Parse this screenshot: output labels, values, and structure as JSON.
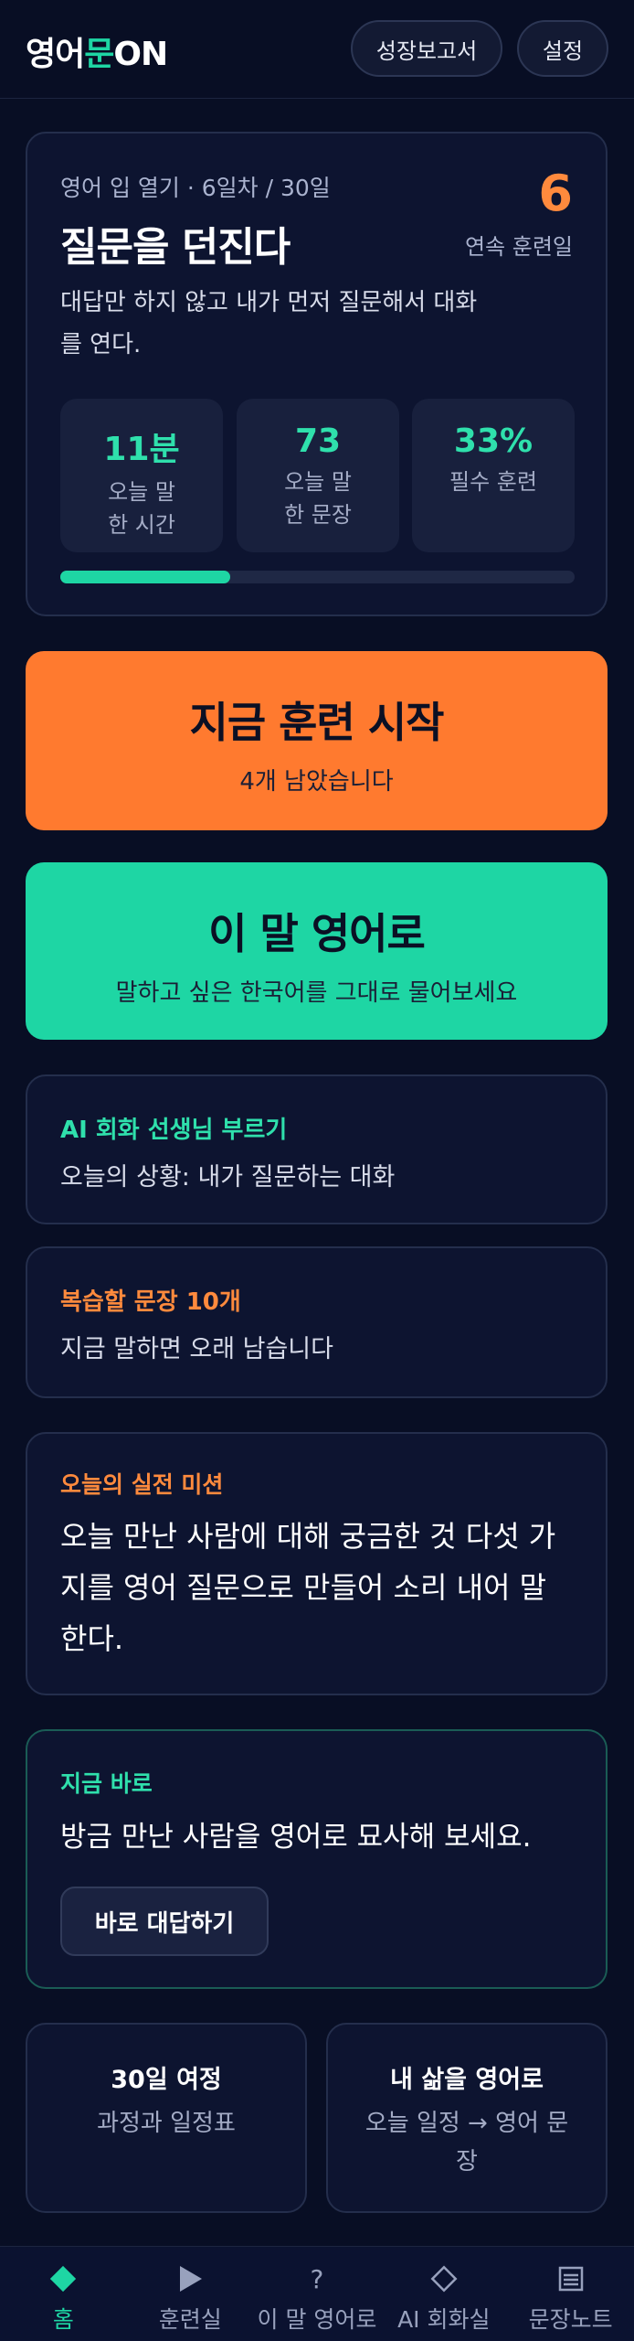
{
  "app": {
    "logo_part1": "영어",
    "logo_accent": "문",
    "logo_part2": "ON",
    "accent_color": "#1ed6a4",
    "orange_color": "#ff7a2f"
  },
  "header": {
    "report_label": "성장보고서",
    "settings_label": "설정"
  },
  "today_card": {
    "meta": "영어 입 열기 · 6일차 / 30일",
    "title": "질문을 던진다",
    "streak_value": "6",
    "streak_label": "연속 훈련일",
    "description": "대답만 하지 않고 내가 먼저 질문해서 대화를 연다.",
    "stats": [
      {
        "value": "11분",
        "label": "오늘 말한 시간"
      },
      {
        "value": "73",
        "label": "오늘 말한 문장"
      },
      {
        "value": "33%",
        "label": "필수 훈련"
      }
    ],
    "progress": 0.33
  },
  "start_training": {
    "title": "지금 훈련 시작",
    "subtitle": "4개 남았습니다"
  },
  "translate": {
    "title": "이 말 영어로",
    "subtitle": "말하고 싶은 한국어를 그대로 물어보세요"
  },
  "ai_tutor": {
    "title": "AI 회화 선생님 부르기",
    "text": "오늘의 상황: 내가 질문하는 대화"
  },
  "review": {
    "title": "복습할 문장 10개",
    "text": "지금 말하면 오래 남습니다"
  },
  "mission": {
    "title": "오늘의 실전 미션",
    "text": "오늘 만난 사람에 대해 궁금한 것 다섯 가지를 영어 질문으로 만들어 소리 내어 말한다."
  },
  "now": {
    "title": "지금 바로",
    "text": "방금 만난 사람을 영어로 묘사해 보세요.",
    "button_label": "바로 대답하기"
  },
  "journey": {
    "title": "30일 여정",
    "text": "과정과 일정표"
  },
  "life": {
    "title": "내 삶을 영어로",
    "text": "오늘 일정 → 영어 문장"
  },
  "nav": {
    "items": [
      {
        "label": "홈",
        "icon": "diamond-filled-icon"
      },
      {
        "label": "훈련실",
        "icon": "play-icon"
      },
      {
        "label": "이 말 영어로",
        "icon": "question-icon"
      },
      {
        "label": "AI 회화실",
        "icon": "diamond-outline-icon"
      },
      {
        "label": "문장노트",
        "icon": "notes-icon"
      }
    ]
  }
}
